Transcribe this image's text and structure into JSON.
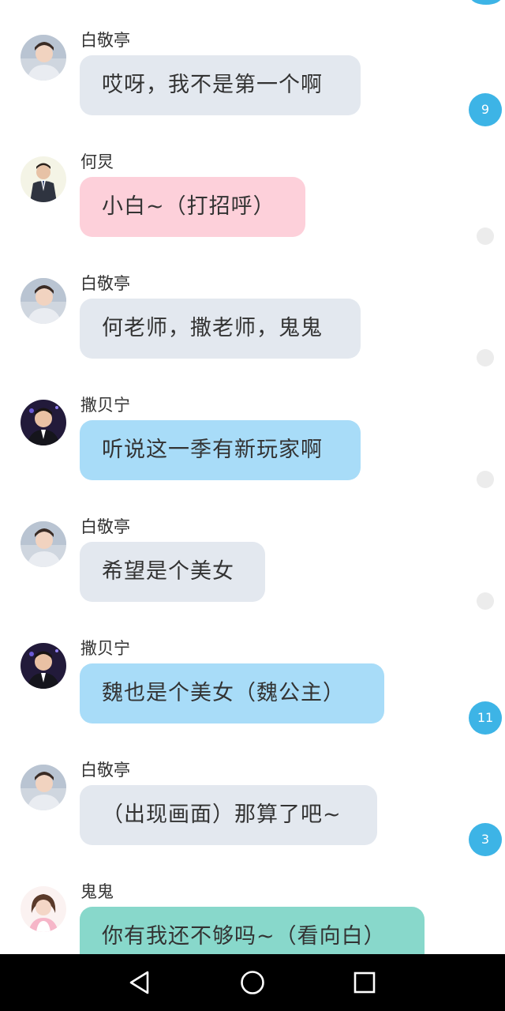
{
  "colors": {
    "gray_bubble": "#e3e8ef",
    "pink_bubble": "#fdd0da",
    "blue_bubble": "#a8dcf8",
    "teal_bubble": "#88d8cb",
    "badge": "#3db4e6",
    "dot": "#ececec"
  },
  "messages": [
    {
      "sender": "白敬亭",
      "text": "哎呀，我不是第一个啊",
      "badge": "9"
    },
    {
      "sender": "何炅",
      "text": "小白~（打招呼）"
    },
    {
      "sender": "白敬亭",
      "text": "何老师，撒老师，鬼鬼"
    },
    {
      "sender": "撒贝宁",
      "text": "听说这一季有新玩家啊"
    },
    {
      "sender": "白敬亭",
      "text": "希望是个美女"
    },
    {
      "sender": "撒贝宁",
      "text": "魏也是个美女（魏公主）",
      "badge": "11"
    },
    {
      "sender": "白敬亭",
      "text": "（出现画面）那算了吧~",
      "badge": "3"
    },
    {
      "sender": "鬼鬼",
      "text": "你有我还不够吗~（看向白）"
    }
  ],
  "navbar": {
    "back": "back-triangle",
    "home": "home-circle",
    "recents": "recents-square"
  }
}
